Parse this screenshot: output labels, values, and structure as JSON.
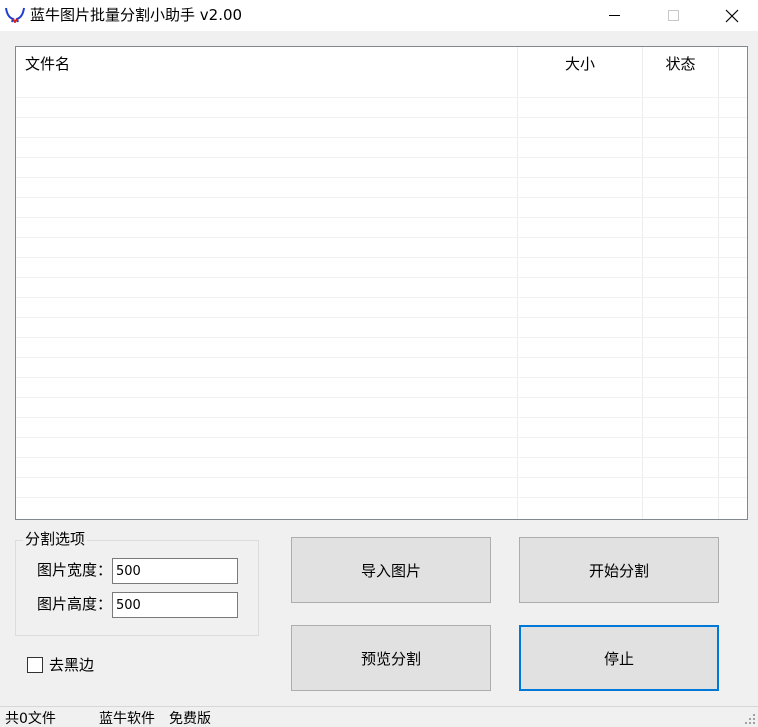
{
  "window": {
    "title": "蓝牛图片批量分割小助手 v2.00",
    "minimize_icon": "minimize-icon",
    "maximize_icon": "maximize-icon",
    "close_icon": "close-icon",
    "app_icon": "bull-horns-logo-icon",
    "app_icon_color": "#1e3fcf",
    "app_icon_accent": "#d81e1e"
  },
  "file_list": {
    "columns": [
      "文件名",
      "大小",
      "状态"
    ],
    "rows": []
  },
  "split_options": {
    "legend": "分割选项",
    "width_label": "图片宽度：",
    "width_value": "500",
    "height_label": "图片高度：",
    "height_value": "500"
  },
  "remove_black_border": {
    "label": "去黑边",
    "checked": false
  },
  "buttons": {
    "import": "导入图片",
    "start": "开始分割",
    "preview": "预览分割",
    "stop": "停止"
  },
  "statusbar": {
    "file_count": "共0文件",
    "brand": "蓝牛软件",
    "edition": "免费版"
  },
  "colors": {
    "accent": "#0078d7"
  }
}
